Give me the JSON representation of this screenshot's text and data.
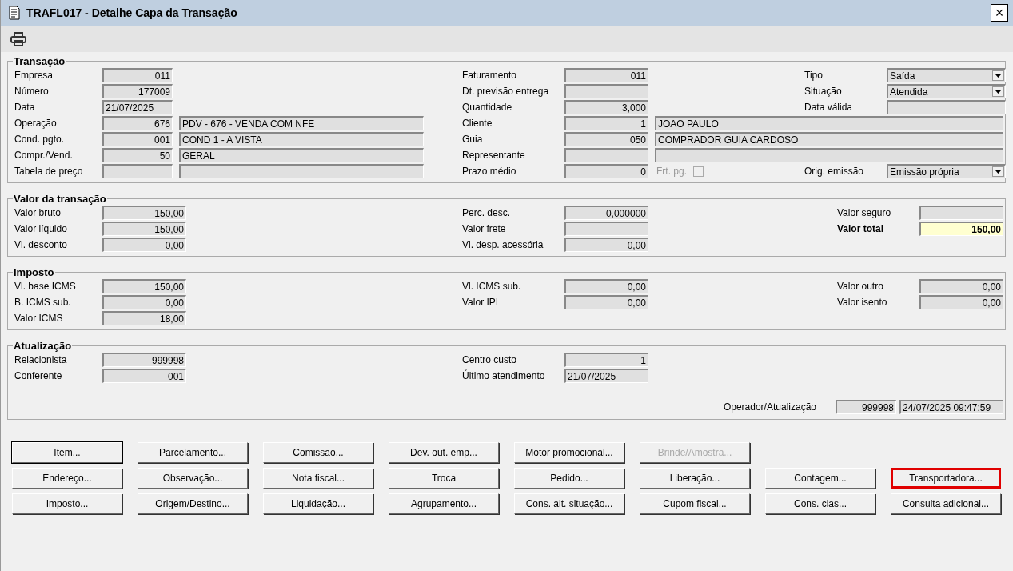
{
  "window": {
    "title": "TRAFL017 - Detalhe Capa da Transação",
    "close": "×"
  },
  "sections": [
    {
      "title": "Transação",
      "rows": [
        {
          "left": {
            "label": "Empresa",
            "value": "011"
          },
          "middle": {
            "label": "Faturamento",
            "value": "011"
          },
          "right": {
            "label": "Tipo",
            "value": "Saída",
            "kind": "dropdown"
          }
        },
        {
          "left": {
            "label": "Número",
            "value": "177009"
          },
          "middle": {
            "label": "Dt. previsão entrega"
          },
          "right": {
            "label": "Situação",
            "value": "Atendida",
            "kind": "dropdown"
          }
        },
        {
          "left": {
            "label": "Data",
            "value": "21/07/2025",
            "kind": "date"
          },
          "middle": {
            "label": "Quantidade",
            "value": "3,000"
          },
          "right": {
            "label": "Data válida"
          }
        },
        {
          "left": {
            "label": "Operação",
            "value": "676",
            "desc": "PDV - 676 - VENDA COM NFE"
          },
          "middle": {
            "label": "Cliente",
            "value": "1",
            "desc": "JOAO PAULO"
          }
        },
        {
          "left": {
            "label": "Cond. pgto.",
            "value": "001",
            "desc": "COND 1 - A VISTA"
          },
          "middle": {
            "label": "Guia",
            "value": "050",
            "desc": "COMPRADOR GUIA CARDOSO"
          }
        },
        {
          "left": {
            "label": "Compr./Vend.",
            "value": "50",
            "desc": "GERAL"
          },
          "middle": {
            "label": "Representante",
            "kind": "code_desc"
          }
        },
        {
          "left": {
            "label": "Tabela de preço",
            "kind": "code_desc"
          },
          "middle": {
            "label": "Prazo médio",
            "value": "0",
            "check": {
              "label": "Frt. pg.",
              "checked": false,
              "disabled": true
            }
          },
          "right": {
            "label": "Orig. emissão",
            "value": "Emissão própria",
            "kind": "dropdown"
          }
        }
      ]
    },
    {
      "title": "Valor da transação",
      "rows": [
        {
          "left": {
            "label": "Valor bruto",
            "value": "150,00"
          },
          "middle": {
            "label": "Perc. desc.",
            "value": "0,000000"
          },
          "right": {
            "label": "Valor seguro"
          }
        },
        {
          "left": {
            "label": "Valor líquido",
            "value": "150,00"
          },
          "middle": {
            "label": "Valor frete"
          },
          "right": {
            "label": "Valor total",
            "value": "150,00",
            "kind": "total"
          }
        },
        {
          "left": {
            "label": "Vl. desconto",
            "value": "0,00"
          },
          "middle": {
            "label": "Vl. desp. acessória",
            "value": "0,00"
          }
        }
      ]
    },
    {
      "title": "Imposto",
      "rows": [
        {
          "left": {
            "label": "Vl. base ICMS",
            "value": "150,00"
          },
          "middle": {
            "label": "Vl. ICMS sub.",
            "value": "0,00"
          },
          "right": {
            "label": "Valor outro",
            "value": "0,00"
          }
        },
        {
          "left": {
            "label": "B. ICMS sub.",
            "value": "0,00"
          },
          "middle": {
            "label": "Valor IPI",
            "value": "0,00"
          },
          "right": {
            "label": "Valor isento",
            "value": "0,00"
          }
        },
        {
          "left": {
            "label": "Valor ICMS",
            "value": "18,00"
          }
        }
      ]
    },
    {
      "title": "Atualização",
      "rows": [
        {
          "left": {
            "label": "Relacionista",
            "value": "999998"
          },
          "middle": {
            "label": "Centro custo",
            "value": "1"
          }
        },
        {
          "left": {
            "label": "Conferente",
            "value": "001"
          },
          "middle": {
            "label": "Último atendimento",
            "value": "21/07/2025",
            "kind": "date"
          }
        }
      ],
      "footer": {
        "label": "Operador/Atualização",
        "values": [
          "999998",
          "24/07/2025 09:47:59"
        ]
      }
    }
  ],
  "buttons": [
    [
      {
        "label": "Item...",
        "disabled": false,
        "highlighted": false
      },
      {
        "label": "Parcelamento...",
        "disabled": false,
        "highlighted": false
      },
      {
        "label": "Comissão...",
        "disabled": false,
        "highlighted": false
      },
      {
        "label": "Dev. out. emp...",
        "disabled": false,
        "highlighted": false
      },
      {
        "label": "Motor promocional...",
        "disabled": false,
        "highlighted": false
      },
      {
        "label": "Brinde/Amostra...",
        "disabled": true,
        "highlighted": false
      }
    ],
    [
      {
        "label": "Endereço...",
        "disabled": false,
        "highlighted": false
      },
      {
        "label": "Observação...",
        "disabled": false,
        "highlighted": false
      },
      {
        "label": "Nota fiscal...",
        "disabled": false,
        "highlighted": false
      },
      {
        "label": "Troca",
        "disabled": false,
        "highlighted": false
      },
      {
        "label": "Pedido...",
        "disabled": false,
        "highlighted": false
      },
      {
        "label": "Liberação...",
        "disabled": false,
        "highlighted": false
      },
      {
        "label": "Contagem...",
        "disabled": false,
        "highlighted": false
      },
      {
        "label": "Transportadora...",
        "disabled": false,
        "highlighted": true
      }
    ],
    [
      {
        "label": "Imposto...",
        "disabled": false,
        "highlighted": false
      },
      {
        "label": "Origem/Destino...",
        "disabled": false,
        "highlighted": false
      },
      {
        "label": "Liquidação...",
        "disabled": false,
        "highlighted": false
      },
      {
        "label": "Agrupamento...",
        "disabled": false,
        "highlighted": false
      },
      {
        "label": "Cons. alt. situação...",
        "disabled": false,
        "highlighted": false
      },
      {
        "label": "Cupom fiscal...",
        "disabled": false,
        "highlighted": false
      },
      {
        "label": "Cons. clas...",
        "disabled": false,
        "highlighted": false
      },
      {
        "label": "Consulta adicional...",
        "disabled": false,
        "highlighted": false
      }
    ]
  ]
}
